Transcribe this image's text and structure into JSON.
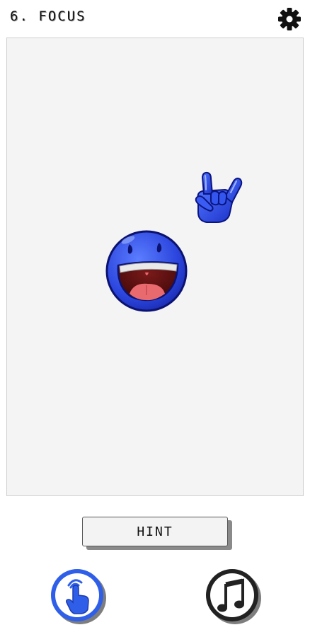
{
  "header": {
    "level_title": "6. Focus",
    "settings_icon": "gear-icon"
  },
  "play_area": {
    "background_color": "#f4f4f4",
    "items": [
      {
        "name": "rock-hand-emoji",
        "icon": "rock-on-hand-icon",
        "color": "#2f4fe0"
      },
      {
        "name": "laughing-smiley-emoji",
        "icon": "laughing-face-icon",
        "color": "#2f4fe0"
      }
    ]
  },
  "hint_button": {
    "label": "Hint"
  },
  "bottom_bar": {
    "tap_button": {
      "icon": "tap-finger-icon",
      "color": "#2f5fe8"
    },
    "music_button": {
      "icon": "music-note-icon",
      "color": "#222222"
    }
  }
}
